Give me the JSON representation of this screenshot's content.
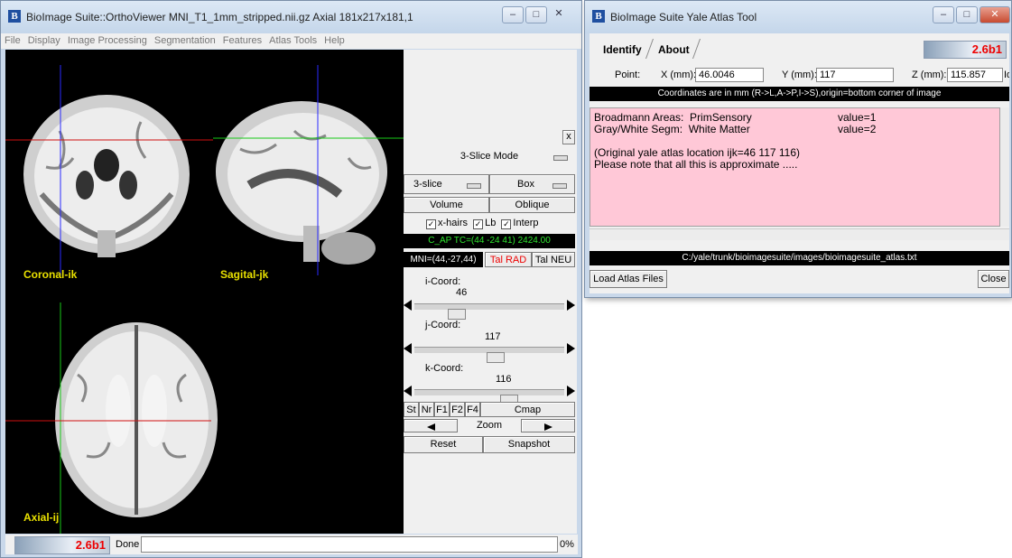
{
  "ortho": {
    "title": "BioImage Suite::OrthoViewer MNI_T1_1mm_stripped.nii.gz Axial 181x217x181,1",
    "icon": "B",
    "menu": [
      "File",
      "Display",
      "Image Processing",
      "Segmentation",
      "Features",
      "Atlas Tools",
      "Help"
    ],
    "views": {
      "coronal": "Coronal-ik",
      "sagittal": "Sagital-jk",
      "axial": "Axial-ij"
    },
    "panel": {
      "close": "x",
      "mode": "3-Slice Mode",
      "slice_sel": "3-slice",
      "box_sel": "Box",
      "volume": "Volume",
      "oblique": "Oblique",
      "xhairs": "x-hairs",
      "lb": "Lb",
      "interp": "Interp",
      "readout": "C_AP TC=(44 -24 41) 2424.00",
      "mni": "MNI=(44,-27,44)",
      "tal_rad": "Tal RAD",
      "tal_neu": "Tal NEU",
      "i_label": "i-Coord:",
      "i_value": "46",
      "j_label": "j-Coord:",
      "j_value": "117",
      "k_label": "k-Coord:",
      "k_value": "116",
      "i_frac": 0.25,
      "j_frac": 0.54,
      "k_frac": 0.64,
      "st": "St",
      "nr": "Nr",
      "f1": "F1",
      "f2": "F2",
      "f4": "F4",
      "cmap": "Cmap",
      "zoom": "Zoom",
      "reset": "Reset",
      "snapshot": "Snapshot"
    },
    "status": {
      "version": "2.6b1",
      "text": "Done",
      "percent": "0%"
    }
  },
  "atlas": {
    "title": "BioImage Suite Yale Atlas Tool",
    "icon": "B",
    "tabs": [
      "Identify",
      "About"
    ],
    "version": "2.6b1",
    "point_label": "Point:",
    "x_label": "X (mm):",
    "x_value": "46.0046",
    "y_label": "Y (mm):",
    "y_value": "117",
    "z_label": "Z (mm):",
    "z_value": "115.857",
    "identify": "Identify",
    "coord_note": "Coordinates are in mm (R->L,A->P,I->S),origin=bottom corner of image",
    "results": [
      {
        "name": "Broadmann Areas:  PrimSensory",
        "value": "value=1"
      },
      {
        "name": "Gray/White Segm:  White Matter",
        "value": "value=2"
      }
    ],
    "location_note": "(Original yale atlas location ijk=46 117 116)",
    "approx_note": "Please note that all this is approximate .....",
    "atlas_path": "C:/yale/trunk/bioimagesuite/images/bioimagesuite_atlas.txt",
    "load": "Load Atlas Files",
    "close": "Close"
  },
  "colors": {
    "crosshair_blue": "#2a2aff",
    "crosshair_red": "#d01010",
    "crosshair_green": "#18c818",
    "label_yellow": "#e8e000",
    "pink": "#ffc8d7"
  }
}
